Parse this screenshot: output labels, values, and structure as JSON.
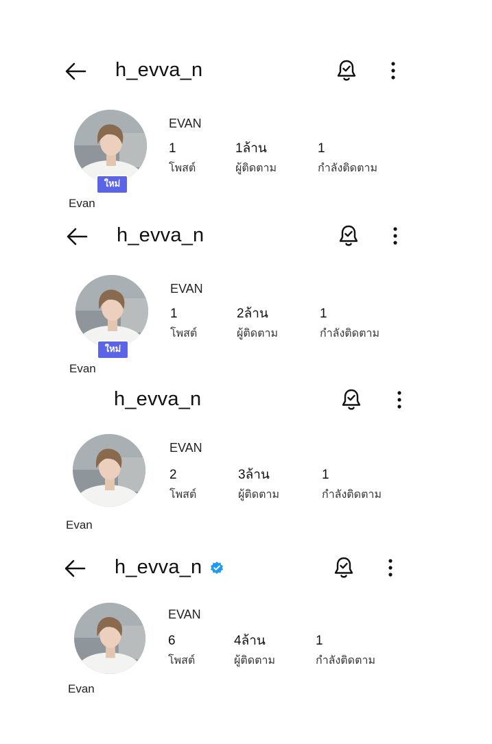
{
  "panels": [
    {
      "username": "h_evva_n",
      "display_name": "EVAN",
      "real_name": "Evan",
      "badge": "ใหม่",
      "stats": {
        "posts_value": "1",
        "posts_label": "โพสต์",
        "followers_value": "1ล้าน",
        "followers_label": "ผู้ติดตาม",
        "following_value": "1",
        "following_label": "กำลังติดตาม"
      }
    },
    {
      "username": "h_evva_n",
      "display_name": "EVAN",
      "real_name": "Evan",
      "badge": "ใหม่",
      "stats": {
        "posts_value": "1",
        "posts_label": "โพสต์",
        "followers_value": "2ล้าน",
        "followers_label": "ผู้ติดตาม",
        "following_value": "1",
        "following_label": "กำลังติดตาม"
      }
    },
    {
      "username": "h_evva_n",
      "display_name": "EVAN",
      "real_name": "Evan",
      "stats": {
        "posts_value": "2",
        "posts_label": "โพสต์",
        "followers_value": "3ล้าน",
        "followers_label": "ผู้ติดตาม",
        "following_value": "1",
        "following_label": "กำลังติดตาม"
      }
    },
    {
      "username": "h_evva_n",
      "verified": true,
      "display_name": "EVAN",
      "real_name": "Evan",
      "stats": {
        "posts_value": "6",
        "posts_label": "โพสต์",
        "followers_value": "4ล้าน",
        "followers_label": "ผู้ติดตาม",
        "following_value": "1",
        "following_label": "กำลังติดตาม"
      }
    }
  ],
  "icons": {
    "back": "arrow-left-icon",
    "notifications": "bell-check-icon",
    "more": "vertical-dots-icon",
    "verified": "verified-badge-icon"
  },
  "colors": {
    "badge_background": "#5b64e6",
    "verified_blue": "#1d9bf0",
    "text": "#111111"
  }
}
